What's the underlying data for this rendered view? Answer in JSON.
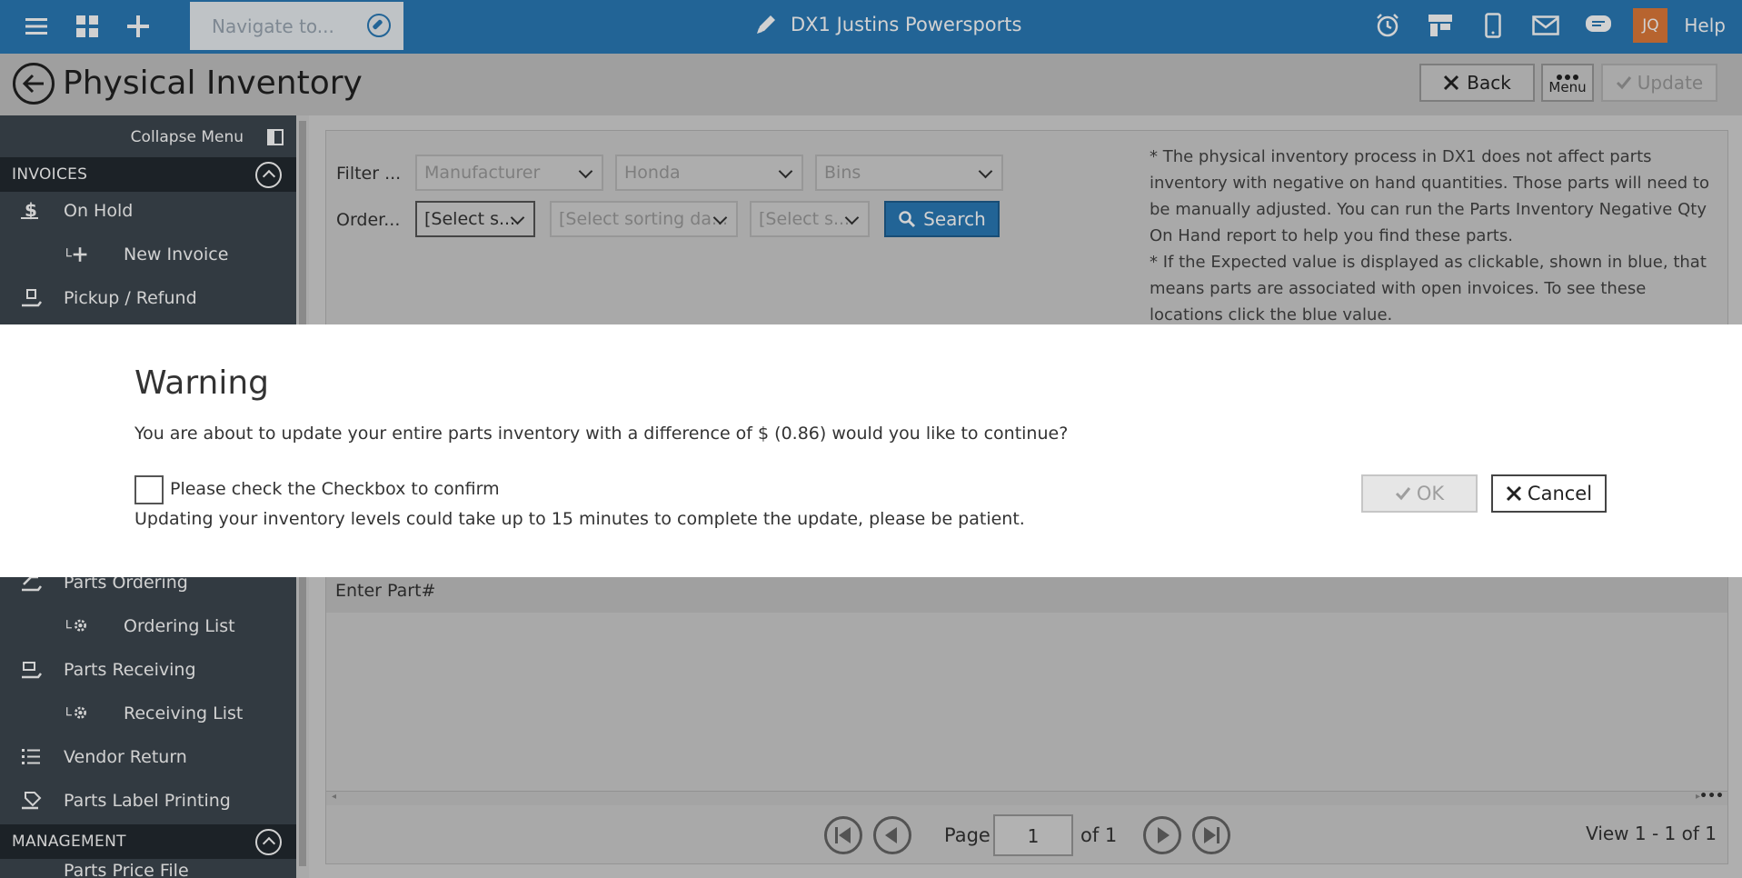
{
  "topbar": {
    "nav_placeholder": "Navigate to...",
    "dealer_name": "DX1 Justins Powersports",
    "user_initials": "JQ",
    "help_label": "Help"
  },
  "header": {
    "page_title": "Physical Inventory",
    "back_label": "Back",
    "menu_label": "Menu",
    "update_label": "Update"
  },
  "sidebar": {
    "collapse_label": "Collapse Menu",
    "sections": {
      "invoices": "INVOICES",
      "management": "MANAGEMENT"
    },
    "items": {
      "on_hold": "On Hold",
      "new_invoice": "New Invoice",
      "pickup_refund": "Pickup / Refund",
      "parts_ordering": "Parts Ordering",
      "ordering_list": "Ordering List",
      "parts_receiving": "Parts Receiving",
      "receiving_list": "Receiving List",
      "vendor_return": "Vendor Return",
      "parts_label_printing": "Parts Label Printing",
      "parts_price_file": "Parts Price File"
    }
  },
  "filters": {
    "filter_label": "Filter ...",
    "order_label": "Order...",
    "manufacturer": "Manufacturer",
    "brand": "Honda",
    "bins": "Bins",
    "order_select_1": "[Select s...",
    "order_select_2": "[Select sorting da...",
    "order_select_3": "[Select s...",
    "search_label": "Search"
  },
  "notice": {
    "line1": "* The physical inventory process in DX1 does not affect parts inventory with negative on hand quantities. Those parts will need to be manually adjusted. You can run the Parts Inventory Negative Qty On Hand report to help you find these parts.",
    "line2": "* If the Expected value is displayed as clickable, shown in blue, that means parts are associated with open invoices. To see these locations click the blue value."
  },
  "grid": {
    "enter_part": "Enter Part#"
  },
  "pager": {
    "page_label": "Page",
    "page_value": "1",
    "of_label": "of 1",
    "view_label": "View 1 - 1 of 1"
  },
  "modal": {
    "title": "Warning",
    "message": "You are about to update your entire parts inventory with a difference of $ (0.86) would you like to continue?",
    "checkbox_label": "Please check the Checkbox to confirm",
    "note": "Updating your inventory levels could take up to 15 minutes to complete the update, please be patient.",
    "ok_label": "OK",
    "cancel_label": "Cancel"
  },
  "colors": {
    "brand_blue": "#2a7ab8",
    "sidebar_bg": "#3d4750",
    "avatar_orange": "#e07a3a"
  }
}
